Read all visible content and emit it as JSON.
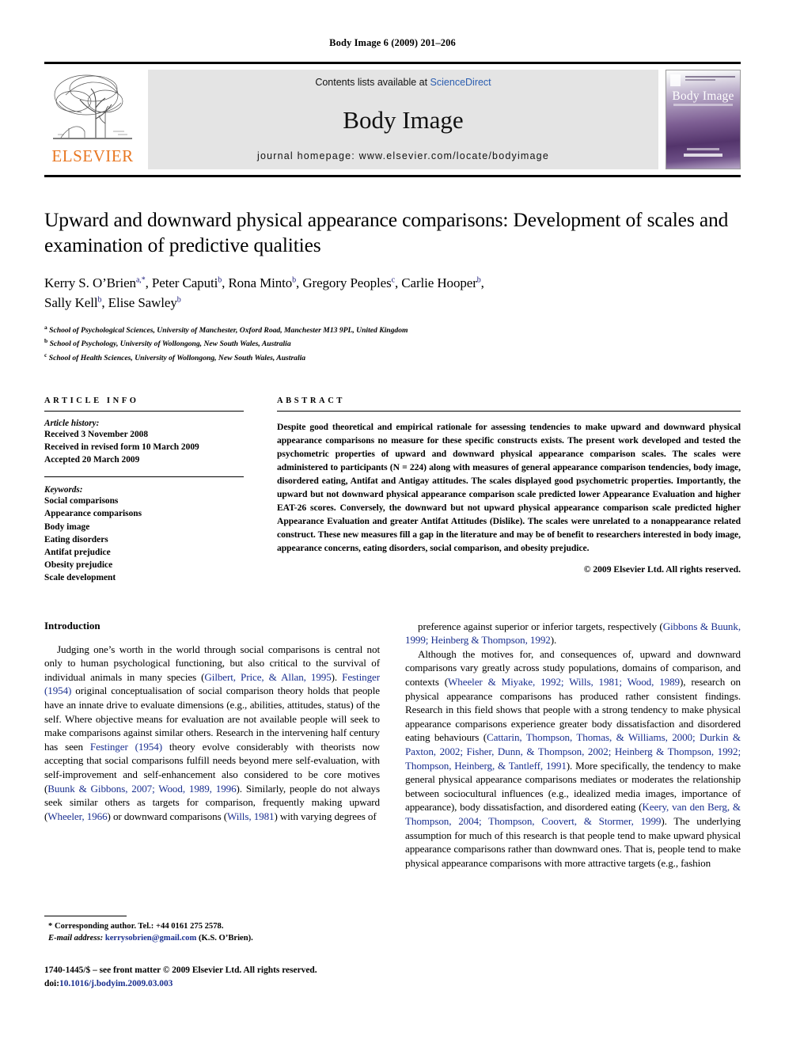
{
  "running_head": "Body Image 6 (2009) 201–206",
  "masthead": {
    "contents_prefix": "Contents lists available at ",
    "contents_link": "ScienceDirect",
    "journal_title": "Body Image",
    "homepage": "journal homepage: www.elsevier.com/locate/bodyimage",
    "publisher_wordmark": "ELSEVIER",
    "cover_title": "Body Image",
    "link_color": "#2A5DB0",
    "elsevier_orange": "#E87722"
  },
  "article": {
    "title": "Upward and downward physical appearance comparisons: Development of scales and examination of predictive qualities",
    "authors_line_1": "Kerry S. O’Brien a,*, Peter Caputi b, Rona Minto b, Gregory Peoples c, Carlie Hooper b,",
    "authors_line_2": "Sally Kell b, Elise Sawley b",
    "affiliations": [
      "a School of Psychological Sciences, University of Manchester, Oxford Road, Manchester M13 9PL, United Kingdom",
      "b School of Psychology, University of Wollongong, New South Wales, Australia",
      "c School of Health Sciences, University of Wollongong, New South Wales, Australia"
    ]
  },
  "info": {
    "heading": "ARTICLE INFO",
    "history_label": "Article history:",
    "history": [
      "Received 3 November 2008",
      "Received in revised form 10 March 2009",
      "Accepted 20 March 2009"
    ],
    "keywords_label": "Keywords:",
    "keywords": [
      "Social comparisons",
      "Appearance comparisons",
      "Body image",
      "Eating disorders",
      "Antifat prejudice",
      "Obesity prejudice",
      "Scale development"
    ]
  },
  "abstract": {
    "heading": "ABSTRACT",
    "text": "Despite good theoretical and empirical rationale for assessing tendencies to make upward and downward physical appearance comparisons no measure for these specific constructs exists. The present work developed and tested the psychometric properties of upward and downward physical appearance comparison scales. The scales were administered to participants (N = 224) along with measures of general appearance comparison tendencies, body image, disordered eating, Antifat and Antigay attitudes. The scales displayed good psychometric properties. Importantly, the upward but not downward physical appearance comparison scale predicted lower Appearance Evaluation and higher EAT-26 scores. Conversely, the downward but not upward physical appearance comparison scale predicted higher Appearance Evaluation and greater Antifat Attitudes (Dislike). The scales were unrelated to a nonappearance related construct. These new measures fill a gap in the literature and may be of benefit to researchers interested in body image, appearance concerns, eating disorders, social comparison, and obesity prejudice.",
    "copyright": "© 2009 Elsevier Ltd. All rights reserved."
  },
  "body": {
    "section_heading": "Introduction",
    "left_paragraph_1": "Judging one’s worth in the world through social comparisons is central not only to human psychological functioning, but also critical to the survival of individual animals in many species (Gilbert, Price, & Allan, 1995). Festinger (1954) original conceptualisation of social comparison theory holds that people have an innate drive to evaluate dimensions (e.g., abilities, attitudes, status) of the self. Where objective means for evaluation are not available people will seek to make comparisons against similar others. Research in the intervening half century has seen Festinger (1954) theory evolve considerably with theorists now accepting that social comparisons fulfill needs beyond mere self-evaluation, with self-improvement and self-enhancement also considered to be core motives (Buunk & Gibbons, 2007; Wood, 1989, 1996). Similarly, people do not always seek similar others as targets for comparison, frequently making upward (Wheeler, 1966) or downward comparisons (Wills, 1981) with varying degrees of",
    "right_paragraph_1": "preference against superior or inferior targets, respectively (Gibbons & Buunk, 1999; Heinberg & Thompson, 1992).",
    "right_paragraph_2": "Although the motives for, and consequences of, upward and downward comparisons vary greatly across study populations, domains of comparison, and contexts (Wheeler & Miyake, 1992; Wills, 1981; Wood, 1989), research on physical appearance comparisons has produced rather consistent findings. Research in this field shows that people with a strong tendency to make physical appearance comparisons experience greater body dissatisfaction and disordered eating behaviours (Cattarin, Thompson, Thomas, & Williams, 2000; Durkin & Paxton, 2002; Fisher, Dunn, & Thompson, 2002; Heinberg & Thompson, 1992; Thompson, Heinberg, & Tantleff, 1991). More specifically, the tendency to make general physical appearance comparisons mediates or moderates the relationship between sociocultural influences (e.g., idealized media images, importance of appearance), body dissatisfaction, and disordered eating (Keery, van den Berg, & Thompson, 2004; Thompson, Coovert, & Stormer, 1999). The underlying assumption for much of this research is that people tend to make upward physical appearance comparisons rather than downward ones. That is, people tend to make physical appearance comparisons with more attractive targets (e.g., fashion"
  },
  "footnotes": {
    "corresponding": "* Corresponding author. Tel.: +44 0161 275 2578.",
    "email_label": "E-mail address:",
    "email": "kerrysobrien@gmail.com",
    "email_owner": "(K.S. O’Brien).",
    "issn_line": "1740-1445/$ – see front matter © 2009 Elsevier Ltd. All rights reserved.",
    "doi_label": "doi:",
    "doi": "10.1016/j.bodyim.2009.03.003"
  }
}
